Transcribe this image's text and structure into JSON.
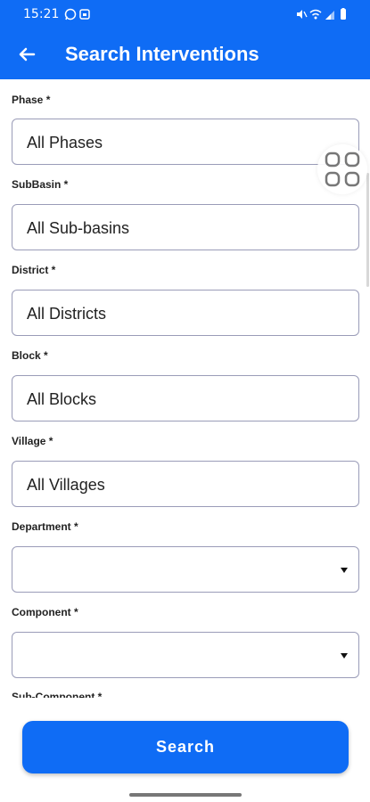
{
  "status_bar": {
    "time": "15:21"
  },
  "app_bar": {
    "title": "Search Interventions"
  },
  "fields": [
    {
      "label": "Phase *",
      "value": "All Phases"
    },
    {
      "label": "SubBasin *",
      "value": "All Sub-basins"
    },
    {
      "label": "District *",
      "value": "All Districts"
    },
    {
      "label": "Block *",
      "value": "All Blocks"
    },
    {
      "label": "Village *",
      "value": "All Villages"
    },
    {
      "label": "Department *",
      "value": ""
    },
    {
      "label": "Component *",
      "value": ""
    },
    {
      "label": "Sub-Component *"
    }
  ],
  "search_button": {
    "label": "Search"
  },
  "icons": {
    "back": "arrow-left-icon",
    "grid": "grid-icon",
    "dropdown": "dropdown-arrow-icon"
  },
  "colors": {
    "primary": "#0f6cf5",
    "border": "#9a9cb8"
  }
}
